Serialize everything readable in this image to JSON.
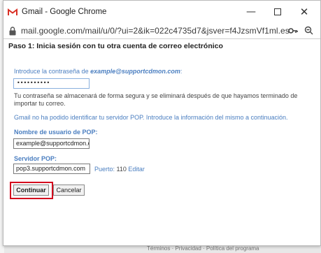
{
  "window": {
    "title": "Gmail - Google Chrome",
    "url": "mail.google.com/mail/u/0/?ui=2&ik=022c4735d7&jsver=f4JzsmVf1ml.es.&cbl..."
  },
  "page": {
    "heading": "Paso 1: Inicia sesión con tu otra cuenta de correo electrónico",
    "password_prompt": "Introduce la contraseña de ",
    "password_email": "example@supportcdmon.com",
    "password_suffix": ":",
    "password_value": "••••••••••",
    "security_note": "Tu contraseña se almacenará de forma segura y se eliminará después de que hayamos terminado de importar tu correo.",
    "pop_notice": "Gmail no ha podido identificar tu servidor POP. Introduce la información del mismo a continuación.",
    "pop_user_label": "Nombre de usuario de POP:",
    "pop_user_value": "example@supportcdmon.com",
    "pop_server_label": "Servidor POP:",
    "pop_server_value": "pop3.supportcdmon.com",
    "port_label": "Puerto: ",
    "port_value": "110",
    "port_edit": "Editar",
    "continue_button": "Continuar",
    "cancel_button": "Cancelar"
  },
  "background": {
    "footer": "Términos · Privacidad · Política del programa"
  },
  "colors": {
    "link_blue": "#4a7ec0",
    "highlight_red": "#d3001d",
    "gmail_red": "#d93025"
  }
}
